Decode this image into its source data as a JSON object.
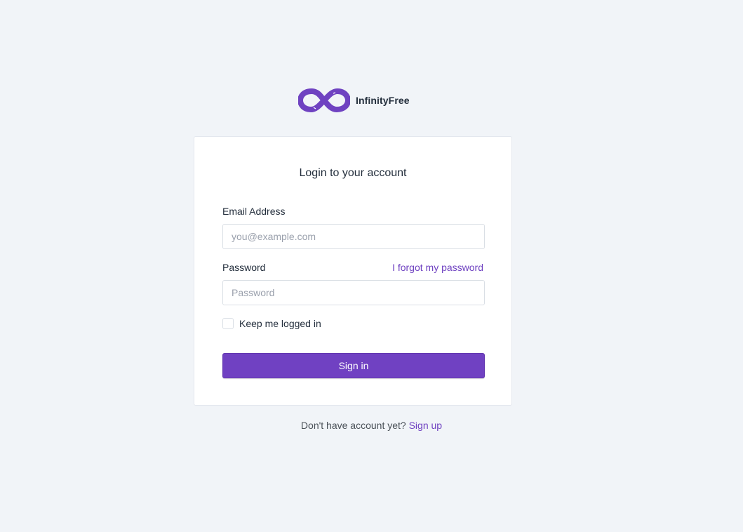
{
  "brand": {
    "name": "InfinityFree",
    "logo_icon": "infinity-icon",
    "logo_color": "#6f42c1"
  },
  "login": {
    "title": "Login to your account",
    "email_label": "Email Address",
    "email_placeholder": "you@example.com",
    "email_value": "",
    "password_label": "Password",
    "password_placeholder": "Password",
    "password_value": "",
    "forgot_link": "I forgot my password",
    "remember_label": "Keep me logged in",
    "remember_checked": false,
    "submit_label": "Sign in"
  },
  "signup": {
    "prompt": "Don't have account yet?",
    "link": "Sign up"
  },
  "colors": {
    "accent": "#7041c2",
    "background": "#f1f4f8",
    "card": "#ffffff"
  }
}
